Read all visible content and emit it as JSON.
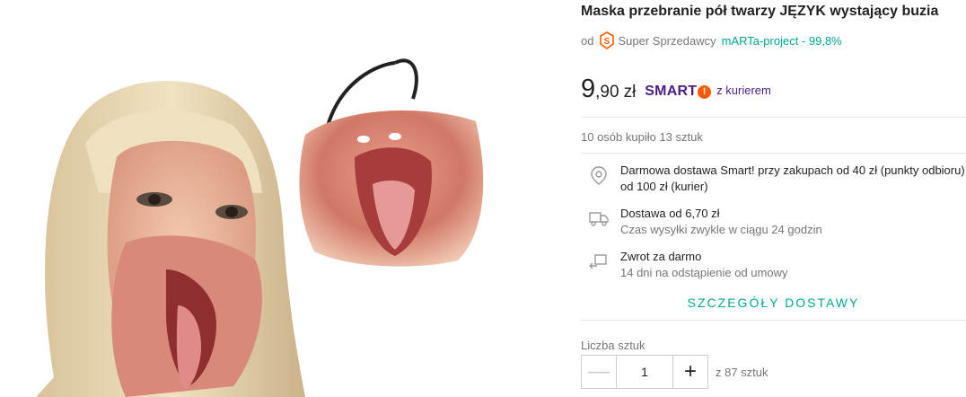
{
  "product": {
    "title": "Maska przebranie pół twarzy JĘZYK wystający buzia"
  },
  "seller": {
    "prefix": "od",
    "badge_label": "Super Sprzedawcy",
    "badge_icon": "super-seller-icon",
    "name": "mARTa-project - 99,8%"
  },
  "price": {
    "integer": "9",
    "decimal": ",90",
    "currency": "zł",
    "smart_label": "SMART",
    "smart_exclamation": "!",
    "courier_label": "z kurierem"
  },
  "purchases": "10 osób kupiło 13 sztuk",
  "shipping": [
    {
      "icon": "location-pin-icon",
      "line1": "Darmowa dostawa Smart! przy zakupach od 40 zł (punkty odbioru)",
      "line2": "od 100 zł (kurier)"
    },
    {
      "icon": "delivery-truck-icon",
      "line1": "Dostawa od 6,70 zł",
      "line2": "Czas wysyłki zwykle w ciągu 24 godzin"
    },
    {
      "icon": "return-icon",
      "line1": "Zwrot za darmo",
      "line2": "14 dni na odstąpienie od umowy"
    }
  ],
  "details_link": "SZCZEGÓŁY DOSTAWY",
  "quantity": {
    "label": "Liczba sztuk",
    "minus": "—",
    "value": "1",
    "plus": "+",
    "available": "z 87 sztuk"
  },
  "colors": {
    "accent_teal": "#00a790",
    "smart_purple": "#4b1e86",
    "smart_orange": "#ff5a00"
  }
}
